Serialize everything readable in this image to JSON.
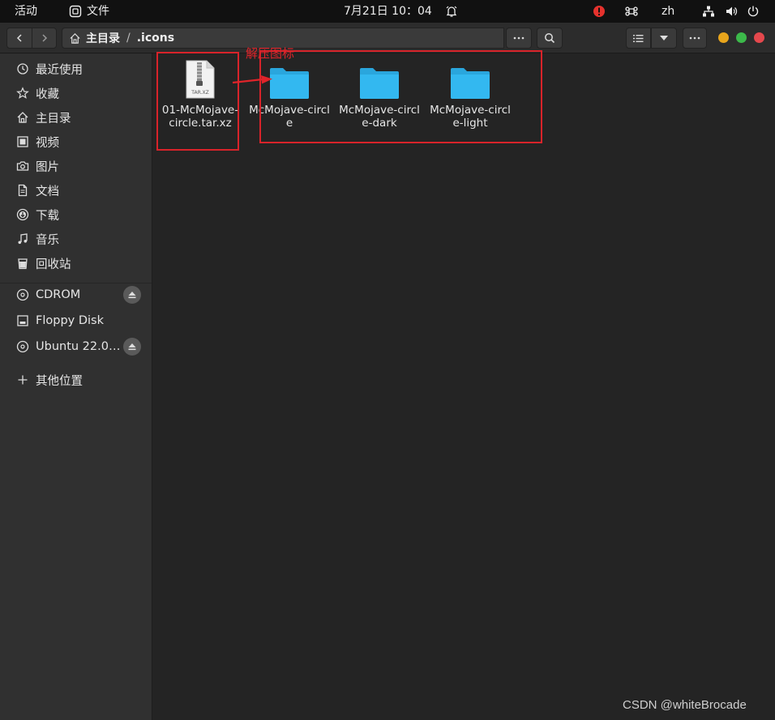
{
  "topbar": {
    "activities": "活动",
    "app_name": "文件",
    "clock": "7月21日  10：04",
    "lang": "zh"
  },
  "headerbar": {
    "path_home": "主目录",
    "path_sep": "/",
    "path_current": ".icons"
  },
  "sidebar": {
    "places": [
      {
        "label": "最近使用",
        "icon": "clock-icon"
      },
      {
        "label": "收藏",
        "icon": "star-icon"
      },
      {
        "label": "主目录",
        "icon": "home-icon"
      },
      {
        "label": "视频",
        "icon": "video-icon"
      },
      {
        "label": "图片",
        "icon": "camera-icon"
      },
      {
        "label": "文档",
        "icon": "document-icon"
      },
      {
        "label": "下载",
        "icon": "download-icon"
      },
      {
        "label": "音乐",
        "icon": "music-icon"
      },
      {
        "label": "回收站",
        "icon": "trash-icon"
      }
    ],
    "devices": [
      {
        "label": "CDROM",
        "icon": "disc-icon",
        "eject": true
      },
      {
        "label": "Floppy Disk",
        "icon": "drive-icon",
        "eject": false
      },
      {
        "label": "Ubuntu 22.0…",
        "icon": "disc-icon",
        "eject": true
      }
    ],
    "other": {
      "label": "其他位置",
      "icon": "plus-icon"
    }
  },
  "files": [
    {
      "name": "01-McMojave-circle.tar.xz",
      "type": "archive",
      "badge": "TAR.XZ"
    },
    {
      "name": "McMojave-circle",
      "type": "folder"
    },
    {
      "name": "McMojave-circle-dark",
      "type": "folder"
    },
    {
      "name": "McMojave-circle-light",
      "type": "folder"
    }
  ],
  "annotation": "解压图标",
  "watermark": "CSDN @whiteBrocade",
  "colors": {
    "folder": "#33b8f0",
    "annotation": "#e0242a",
    "close": "#e5484d",
    "minimize": "#e8a51c",
    "maximize": "#3cb94a"
  }
}
